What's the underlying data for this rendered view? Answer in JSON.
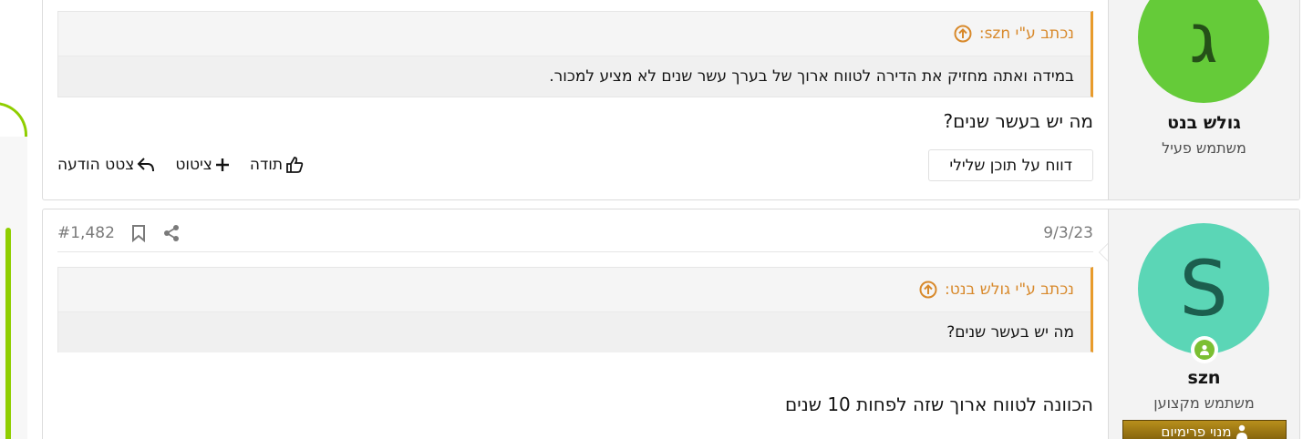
{
  "post1": {
    "avatar_letter": "ג",
    "avatar_color": "#65cb39",
    "username": "גולש בנט",
    "user_title": "משתמש פעיל",
    "quote_author": "נכתב ע\"י szn:",
    "quote_text": "במידה ואתה מחזיק את הדירה לטווח ארוך של בערך עשר שנים לא מציע למכור.",
    "message": "מה יש בעשר שנים?",
    "report_label": "דווח על תוכן שלילי",
    "thanks_label": "תודה",
    "quote_label": "ציטוט",
    "reply_label": "צטט הודעה"
  },
  "post2": {
    "date": "9/3/23",
    "post_number": "#1,482",
    "avatar_letter": "S",
    "avatar_color": "#5bd6b6",
    "username": "szn",
    "user_title": "משתמש מקצוען",
    "banner_label": "מנוי פרימיום",
    "quote_author": "נכתב ע\"י גולש בנט:",
    "quote_text": "מה יש בעשר שנים?",
    "message": "הכוונה לטווח ארוך שזה לפחות 10 שנים"
  },
  "colors": {
    "accent": "#e89b2c",
    "sidebar": "#8fce00",
    "banner": "#9c7612"
  }
}
